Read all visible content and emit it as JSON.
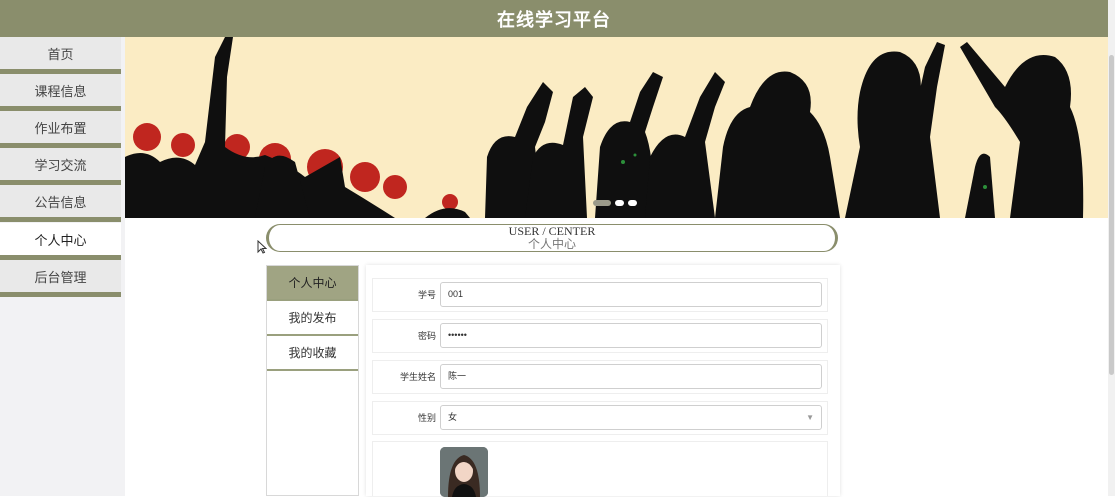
{
  "header": {
    "title": "在线学习平台"
  },
  "sidebar": {
    "items": [
      {
        "label": "首页"
      },
      {
        "label": "课程信息"
      },
      {
        "label": "作业布置"
      },
      {
        "label": "学习交流"
      },
      {
        "label": "公告信息"
      },
      {
        "label": "个人中心",
        "active": true
      },
      {
        "label": "后台管理"
      }
    ]
  },
  "section_title": {
    "en": "USER / CENTER",
    "cn": "个人中心"
  },
  "tabs": [
    {
      "label": "个人中心",
      "active": true
    },
    {
      "label": "我的发布"
    },
    {
      "label": "我的收藏"
    }
  ],
  "form": {
    "student_id": {
      "label": "学号",
      "value": "001"
    },
    "password": {
      "label": "密码",
      "value": "••••••"
    },
    "student_name": {
      "label": "学生姓名",
      "value": "陈一"
    },
    "gender": {
      "label": "性别",
      "value": "女"
    }
  },
  "colors": {
    "accent": "#8a8e6c",
    "banner_bg": "#fbecc4",
    "active_tab": "#a0a483"
  }
}
